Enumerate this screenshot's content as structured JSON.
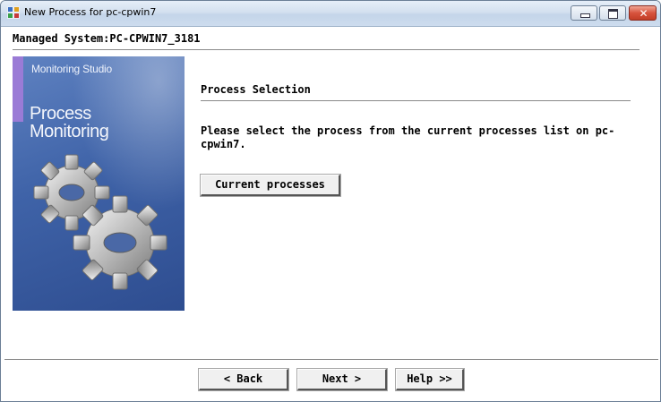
{
  "window": {
    "title": "New Process for pc-cpwin7",
    "icon": "app-icon",
    "controls": {
      "minimize": "minimize-icon",
      "maximize": "maximize-icon",
      "close": "close-icon",
      "close_glyph": "✕"
    }
  },
  "header": {
    "managed_system": "Managed System:PC-CPWIN7_3181"
  },
  "banner": {
    "subtitle": "Monitoring Studio",
    "title": "Process\nMonitoring",
    "graphic": "gears-icon"
  },
  "main": {
    "section_title": "Process Selection",
    "description": "Please select the process from the current processes list on pc-cpwin7.",
    "current_processes_label": "Current processes"
  },
  "footer": {
    "back_label": "< Back",
    "next_label": "Next >",
    "help_label": "Help >>"
  }
}
